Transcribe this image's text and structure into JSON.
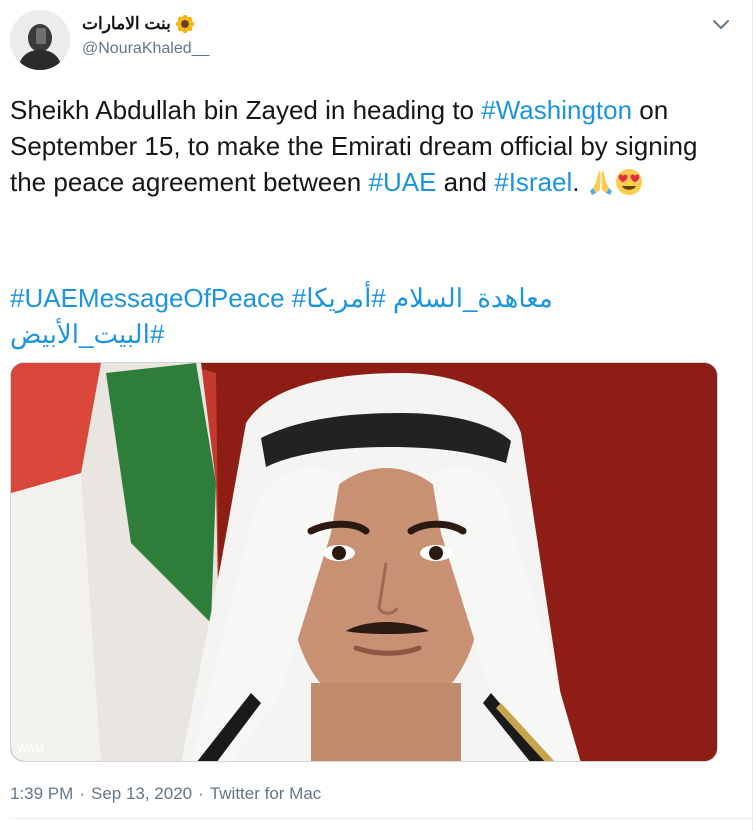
{
  "tweet": {
    "author": {
      "display_name": "بنت الامارات",
      "name_emoji": "sunflower-icon",
      "handle": "@NouraKhaled__"
    },
    "body": {
      "part1": "Sheikh Abdullah bin Zayed in heading to ",
      "tag1": "#Washington",
      "part2": " on September 15, to make the Emirati dream official by signing the peace agreement between ",
      "tag2": "#UAE",
      "part3": " and ",
      "tag3": "#Israel",
      "part4": ". ",
      "emojis": [
        "folded-hands-emoji",
        "heart-eyes-emoji"
      ]
    },
    "hashtags": {
      "line1": "#UAEMessageOfPeace #معاهدة_السلام #أمريكا",
      "line2": "#البيت_الأبيض"
    },
    "media": {
      "watermark": "WAM"
    },
    "meta": {
      "time": "1:39 PM",
      "sep1": "·",
      "date": "Sep 13, 2020",
      "sep2": "·",
      "source": "Twitter for Mac"
    },
    "colors": {
      "link": "#1b95e0",
      "text": "#14171a",
      "secondary": "#657786",
      "photo_bg": "#8b1a14"
    }
  }
}
